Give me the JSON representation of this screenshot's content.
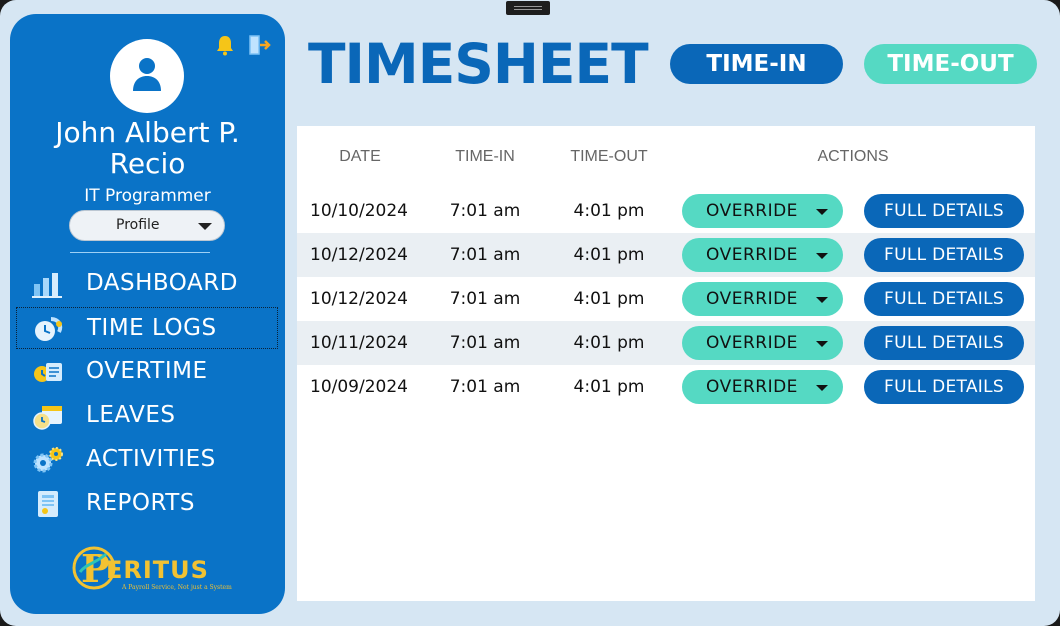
{
  "user": {
    "name_line1": "John Albert P.",
    "name_line2": "Recio",
    "role": "IT Programmer",
    "profile_select": "Profile"
  },
  "header_icons": [
    "bell-icon",
    "logout-icon"
  ],
  "nav": {
    "items": [
      {
        "label": "DASHBOARD",
        "icon": "bar-chart-icon"
      },
      {
        "label": "TIME LOGS",
        "icon": "clock-icon"
      },
      {
        "label": "OVERTIME",
        "icon": "overtime-icon"
      },
      {
        "label": "LEAVES",
        "icon": "calendar-clock-icon"
      },
      {
        "label": "ACTIVITIES",
        "icon": "gears-icon"
      },
      {
        "label": "REPORTS",
        "icon": "report-icon"
      }
    ],
    "active": "TIME LOGS"
  },
  "brand": {
    "name": "ERITUS",
    "initial": "P",
    "tagline": "A Payroll Service, Not just a System"
  },
  "header": {
    "title": "TIMESHEET",
    "time_in_button": "TIME-IN",
    "time_out_button": "TIME-OUT"
  },
  "table": {
    "columns": [
      "DATE",
      "TIME-IN",
      "TIME-OUT",
      "ACTIONS"
    ],
    "rows": [
      {
        "date": "10/10/2024",
        "time_in": "7:01 am",
        "time_out": "4:01 pm",
        "override": "OVERRIDE",
        "details": "FULL DETAILS"
      },
      {
        "date": "10/12/2024",
        "time_in": "7:01 am",
        "time_out": "4:01 pm",
        "override": "OVERRIDE",
        "details": "FULL DETAILS"
      },
      {
        "date": "10/12/2024",
        "time_in": "7:01 am",
        "time_out": "4:01 pm",
        "override": "OVERRIDE",
        "details": "FULL DETAILS"
      },
      {
        "date": "10/11/2024",
        "time_in": "7:01 am",
        "time_out": "4:01 pm",
        "override": "OVERRIDE",
        "details": "FULL DETAILS"
      },
      {
        "date": "10/09/2024",
        "time_in": "7:01 am",
        "time_out": "4:01 pm",
        "override": "OVERRIDE",
        "details": "FULL DETAILS"
      }
    ]
  },
  "colors": {
    "sidebar": "#0a73c7",
    "primary": "#0a67b8",
    "accent": "#55d9c3",
    "background": "#d6e6f3",
    "brand_gold": "#f2c232"
  }
}
